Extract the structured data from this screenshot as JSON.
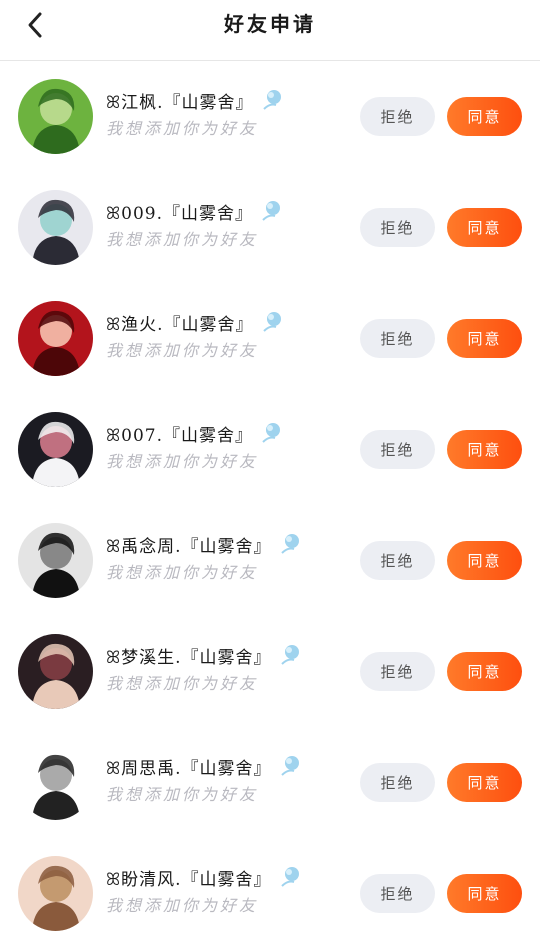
{
  "header": {
    "title": "好友申请",
    "back_icon": "chevron-left-icon"
  },
  "requests": [
    {
      "name": "ꕤ江枫.『山雾舍』",
      "message": "我想添加你为好友",
      "reject_label": "拒绝",
      "accept_label": "同意",
      "avatar_palette": [
        "#6db33f",
        "#2e6b1e",
        "#b7d98b"
      ]
    },
    {
      "name": "ꕤ009.『山雾舍』",
      "message": "我想添加你为好友",
      "reject_label": "拒绝",
      "accept_label": "同意",
      "avatar_palette": [
        "#e8e8ee",
        "#2b2b35",
        "#9fd4d1"
      ]
    },
    {
      "name": "ꕤ渔火.『山雾舍』",
      "message": "我想添加你为好友",
      "reject_label": "拒绝",
      "accept_label": "同意",
      "avatar_palette": [
        "#b3141c",
        "#4d0608",
        "#f0b0a0"
      ]
    },
    {
      "name": "ꕤ007.『山雾舍』",
      "message": "我想添加你为好友",
      "reject_label": "拒绝",
      "accept_label": "同意",
      "avatar_palette": [
        "#1b1b22",
        "#f4f4f6",
        "#c07080"
      ]
    },
    {
      "name": "ꕤ禹念周.『山雾舍』",
      "message": "我想添加你为好友",
      "reject_label": "拒绝",
      "accept_label": "同意",
      "avatar_palette": [
        "#e4e4e4",
        "#111111",
        "#888888"
      ]
    },
    {
      "name": "ꕤ梦溪生.『山雾舍』",
      "message": "我想添加你为好友",
      "reject_label": "拒绝",
      "accept_label": "同意",
      "avatar_palette": [
        "#2a1e22",
        "#e8c9b8",
        "#7a3a40"
      ]
    },
    {
      "name": "ꕤ周思禹.『山雾舍』",
      "message": "我想添加你为好友",
      "reject_label": "拒绝",
      "accept_label": "同意",
      "avatar_palette": [
        "#ffffff",
        "#222222",
        "#aaaaaa"
      ]
    },
    {
      "name": "ꕤ盼清风.『山雾舍』",
      "message": "我想添加你为好友",
      "reject_label": "拒绝",
      "accept_label": "同意",
      "avatar_palette": [
        "#f1d7c8",
        "#8a5a3c",
        "#c49a70"
      ]
    }
  ],
  "badge_icon": "fan-badge-icon",
  "colors": {
    "accept_start": "#ff7a2a",
    "accept_end": "#fe4f0f",
    "reject_bg": "#eceef3",
    "subtext": "#b9b9c0"
  }
}
